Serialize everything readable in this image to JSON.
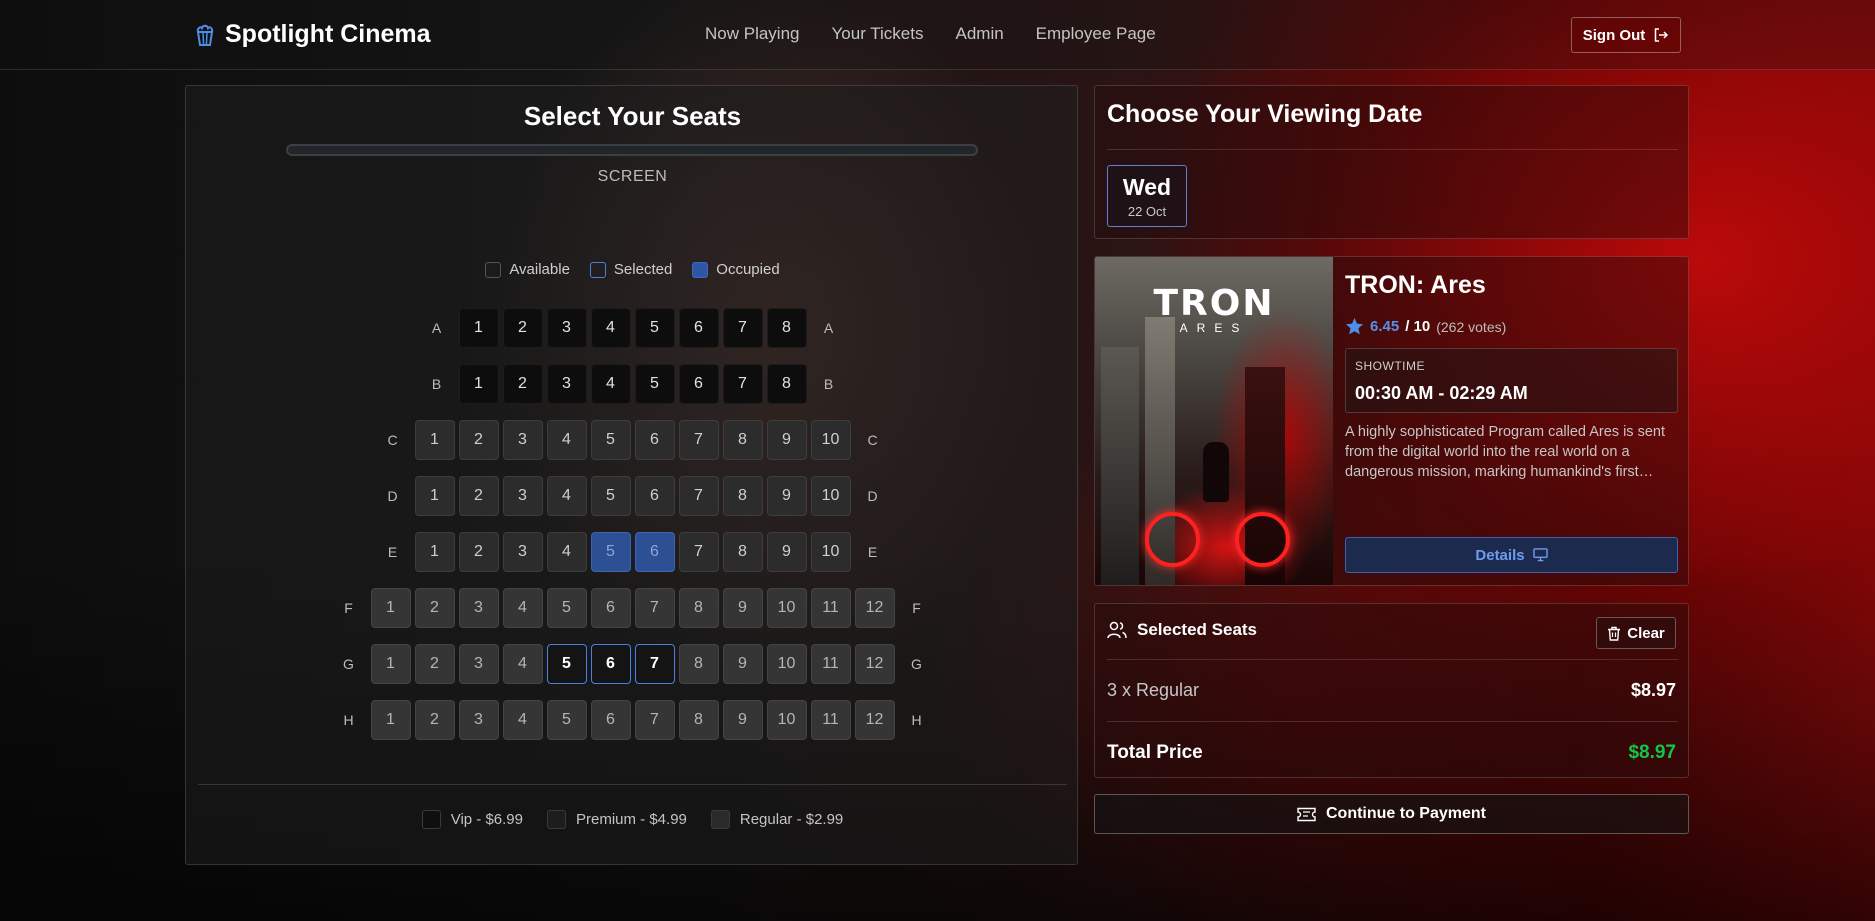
{
  "header": {
    "brand": "Spotlight Cinema",
    "nav": [
      "Now Playing",
      "Your Tickets",
      "Admin",
      "Employee Page"
    ],
    "sign_out": "Sign Out"
  },
  "seat_panel": {
    "title": "Select Your Seats",
    "screen_label": "SCREEN",
    "legend": {
      "available": "Available",
      "selected": "Selected",
      "occupied": "Occupied"
    },
    "rows": [
      {
        "label": "A",
        "tier": "vip",
        "count": 8,
        "occupied": [],
        "selected": []
      },
      {
        "label": "B",
        "tier": "vip",
        "count": 8,
        "occupied": [],
        "selected": []
      },
      {
        "label": "C",
        "tier": "premium",
        "count": 10,
        "occupied": [],
        "selected": []
      },
      {
        "label": "D",
        "tier": "premium",
        "count": 10,
        "occupied": [],
        "selected": []
      },
      {
        "label": "E",
        "tier": "premium",
        "count": 10,
        "occupied": [
          5,
          6
        ],
        "selected": []
      },
      {
        "label": "F",
        "tier": "regular",
        "count": 12,
        "occupied": [],
        "selected": []
      },
      {
        "label": "G",
        "tier": "regular",
        "count": 12,
        "occupied": [],
        "selected": [
          5,
          6,
          7
        ]
      },
      {
        "label": "H",
        "tier": "regular",
        "count": 12,
        "occupied": [],
        "selected": []
      }
    ],
    "price_legend": {
      "vip": "Vip - $6.99",
      "premium": "Premium - $4.99",
      "regular": "Regular - $2.99"
    }
  },
  "date_card": {
    "title": "Choose Your Viewing Date",
    "day": "Wed",
    "date": "22 Oct"
  },
  "movie": {
    "poster_logo": "TRON",
    "poster_sub": "ARES",
    "title": "TRON: Ares",
    "rating": "6.45",
    "rating_max": "/ 10",
    "votes": "(262 votes)",
    "showtime_label": "SHOWTIME",
    "showtime": "00:30 AM - 02:29 AM",
    "synopsis": "A highly sophisticated Program called Ares is sent from the digital world into the real world on a dangerous mission, marking humankind's first encounter with A.I. beings.",
    "details": "Details"
  },
  "summary": {
    "title": "Selected Seats",
    "clear": "Clear",
    "line_label": "3 x Regular",
    "line_value": "$8.97",
    "total_label": "Total Price",
    "total_value": "$8.97"
  },
  "continue": "Continue to Payment",
  "colors": {
    "accent": "#4d7ee0",
    "occupied": "#2d4f94",
    "total": "#16c24a",
    "brand_red": "#8a0a0a"
  },
  "icons": {
    "brand": "popcorn-icon",
    "sign_out": "sign-out-icon",
    "rating": "star-icon",
    "details": "monitor-icon",
    "seats": "users-icon",
    "clear": "trash-icon",
    "continue": "ticket-icon"
  }
}
